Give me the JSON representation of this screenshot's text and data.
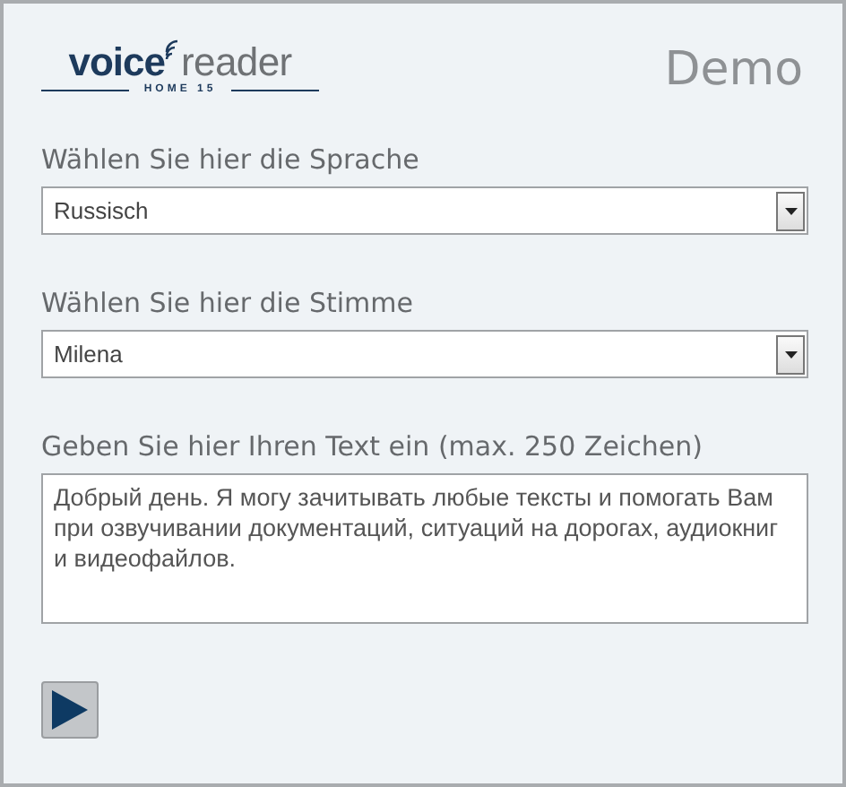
{
  "logo": {
    "word_1": "voice",
    "word_2": "reader",
    "edition": "HOME 15"
  },
  "mode_label": "Demo",
  "fields": [
    {
      "kind": "select",
      "label": "Wählen Sie hier die Sprache",
      "value": "Russisch"
    },
    {
      "kind": "select",
      "label": "Wählen Sie hier die Stimme",
      "value": "Milena"
    },
    {
      "kind": "textarea",
      "label": "Geben Sie hier Ihren Text ein (max. 250 Zeichen)",
      "value": "Добрый день. Я могу зачитывать любые тексты и помогать Вам при озвучивании документаций, ситуаций на дорогах, аудиокниг и видеофайлов."
    }
  ]
}
